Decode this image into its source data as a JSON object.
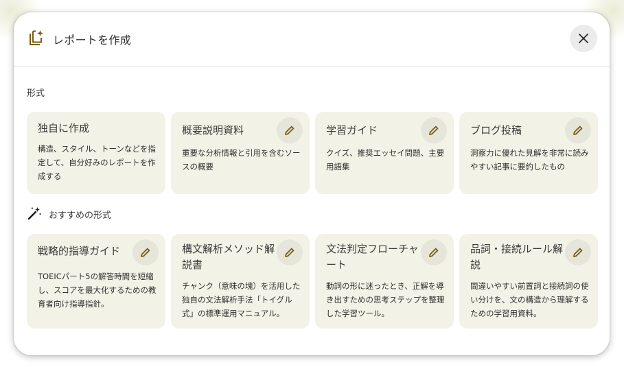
{
  "dialog": {
    "title": "レポートを作成",
    "title_icon": "report-add-icon",
    "close_icon": "close-icon"
  },
  "format_section": {
    "label": "形式",
    "cards": [
      {
        "title": "独自に作成",
        "description": "構造、スタイル、トーンなどを指定して、自分好みのレポートを作成する",
        "editable": false
      },
      {
        "title": "概要説明資料",
        "description": "重要な分析情報と引用を含むソースの概要",
        "editable": true
      },
      {
        "title": "学習ガイド",
        "description": "クイズ、推奨エッセイ問題、主要用語集",
        "editable": true
      },
      {
        "title": "ブログ投稿",
        "description": "洞察力に優れた見解を非常に読みやすい記事に要約したもの",
        "editable": true
      }
    ]
  },
  "recommended_section": {
    "label": "おすすめの形式",
    "icon": "magic-wand-icon",
    "cards": [
      {
        "title": "戦略的指導ガイド",
        "description": "TOEICパート5の解答時間を短縮し、スコアを最大化するための教育者向け指導指針。",
        "editable": true
      },
      {
        "title": "構文解析メソッド解説書",
        "description": "チャンク（意味の塊）を活用した独自の文法解析手法「トイグル式」の標準運用マニュアル。",
        "editable": true
      },
      {
        "title": "文法判定フローチャート",
        "description": "動詞の形に迷ったとき、正解を導き出すための思考ステップを整理した学習ツール。",
        "editable": true
      },
      {
        "title": "品詞・接続ルール解説",
        "description": "間違いやすい前置詞と接続詞の使い分けを、文の構造から理解するための学習用資料。",
        "editable": true
      }
    ]
  },
  "colors": {
    "card_background": "#f3f2e7",
    "edit_button_background": "#e6e5d9",
    "icon_accent": "#7a5a12",
    "close_button_background": "#ebebeb"
  }
}
